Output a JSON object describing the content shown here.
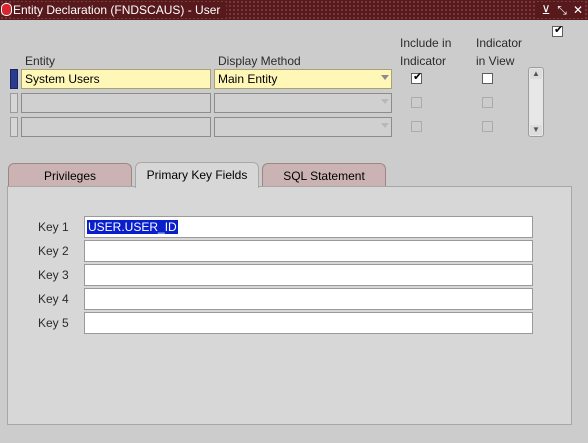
{
  "window": {
    "title": "Entity Declaration (FNDSCAUS) - User",
    "buttons": {
      "minimize": "⊻",
      "restore": "⤡",
      "close": "✕"
    }
  },
  "headers": {
    "entity": "Entity",
    "display_method": "Display Method",
    "include_line1": "Include in",
    "include_line2": "Indicator",
    "indicator_line1": "Indicator",
    "indicator_line2": "in View"
  },
  "rows": [
    {
      "entity": "System Users",
      "display_method": "Main Entity",
      "include_in_indicator": true,
      "indicator_in_view": false
    },
    {
      "entity": "",
      "display_method": "",
      "include_in_indicator": false,
      "indicator_in_view": false
    },
    {
      "entity": "",
      "display_method": "",
      "include_in_indicator": false,
      "indicator_in_view": false
    }
  ],
  "tabs": [
    {
      "label": "Privileges",
      "active": false
    },
    {
      "label": "Primary Key Fields",
      "active": true
    },
    {
      "label": "SQL Statement",
      "active": false
    }
  ],
  "keys": [
    {
      "label": "Key 1",
      "value": "USER.USER_ID"
    },
    {
      "label": "Key 2",
      "value": ""
    },
    {
      "label": "Key 3",
      "value": ""
    },
    {
      "label": "Key 4",
      "value": ""
    },
    {
      "label": "Key 5",
      "value": ""
    }
  ],
  "colors": {
    "title_bar": "#57191c",
    "selected_field": "#fff7b8",
    "selection_highlight": "#0a1fcc",
    "inactive_tab": "#cbb3b3"
  },
  "icons": {
    "window_logo": "oracle-logo-icon",
    "scroll_up": "scroll-up-icon",
    "scroll_down": "scroll-down-icon",
    "dropdown": "chevron-down-icon"
  }
}
